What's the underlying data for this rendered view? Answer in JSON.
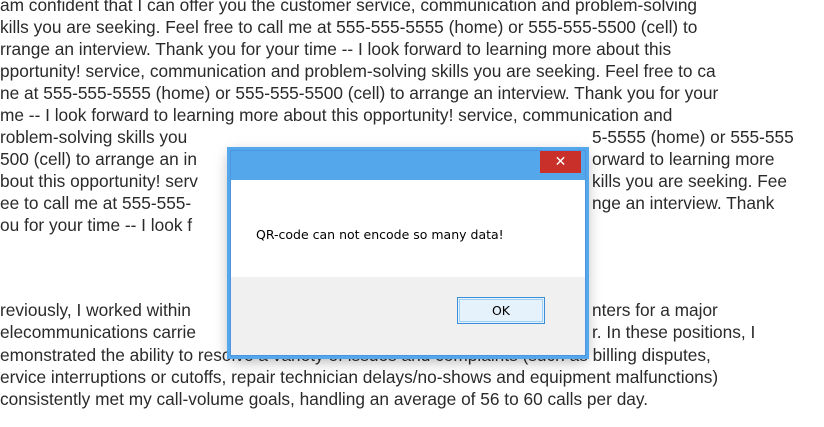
{
  "document": {
    "paragraph1_lines": [
      "am confident that I can offer you the customer service, communication and problem-solving",
      "kills you are seeking. Feel free to call me at 555-555-5555 (home) or 555-555-5500 (cell) to",
      "rrange an interview. Thank you for your time -- I look forward to learning more about this",
      "pportunity! service, communication and problem-solving skills you are seeking. Feel free to ca",
      "ne at 555-555-5555 (home) or 555-555-5500 (cell) to arrange an interview. Thank you for your",
      "me -- I look forward to learning more about this opportunity! service, communication and",
      "roblem-solving skills you",
      "500 (cell) to arrange an in",
      "bout this opportunity! serv",
      "ee to call me at 555-555-",
      "ou for your time -- I look f"
    ],
    "paragraph1_right_fragments": [
      "5-5555 (home) or 555-555",
      "orward to learning more",
      "kills you are seeking. Fee",
      "nge an interview. Thank"
    ],
    "paragraph2_left_fragments": [
      "reviously, I worked within",
      "elecommunications carrie"
    ],
    "paragraph2_right_fragments": [
      "nters for a major",
      "r. In these positions, I"
    ],
    "paragraph2_lines": [
      "emonstrated the ability to resolve a variety of issues and complaints (such as billing disputes,",
      "ervice interruptions or cutoffs, repair technician delays/no-shows and equipment malfunctions)",
      " consistently met my call-volume goals, handling an average of 56 to 60 calls per day."
    ]
  },
  "dialog": {
    "close_label": "✕",
    "message": "QR-code can not encode so many data!",
    "ok_label": "OK"
  },
  "colors": {
    "titlebar": "#54a7ea",
    "close_button": "#c9302a",
    "footer": "#f0f0f0",
    "ok_border": "#3c8ed9"
  }
}
